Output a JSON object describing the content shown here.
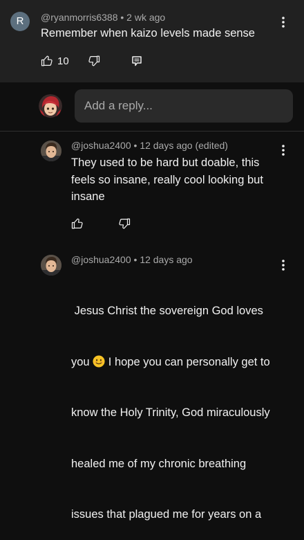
{
  "top_comment": {
    "avatar_letter": "R",
    "author": "@ryanmorris6388",
    "separator": "•",
    "time": "2 wk ago",
    "text": "Remember when kaizo levels made sense",
    "like_count": "10"
  },
  "reply_box": {
    "placeholder": "Add a reply..."
  },
  "replies": [
    {
      "author": "@joshua2400",
      "separator": "•",
      "time": "12 days ago (edited)",
      "lines": [
        "They used to be hard but doable, this",
        "feels so insane, really cool looking but",
        "insane"
      ]
    },
    {
      "author": "@joshua2400",
      "separator": "•",
      "time": "12 days ago",
      "line1": " Jesus Christ the sovereign God loves",
      "line2a": "you",
      "line2b": " I hope you can personally get to",
      "line3": "know the Holy Trinity, God miraculously",
      "line4": "healed me of my chronic breathing",
      "line5": "issues that plagued me for years on a"
    }
  ],
  "colors": {
    "background": "#0f0f0f",
    "top_comment_bg": "#212121",
    "input_bg": "#2a2a2a",
    "meta_text": "#aaaaaa",
    "primary_text": "#f1f1f1",
    "avatar_r": "#5c6f7e"
  }
}
